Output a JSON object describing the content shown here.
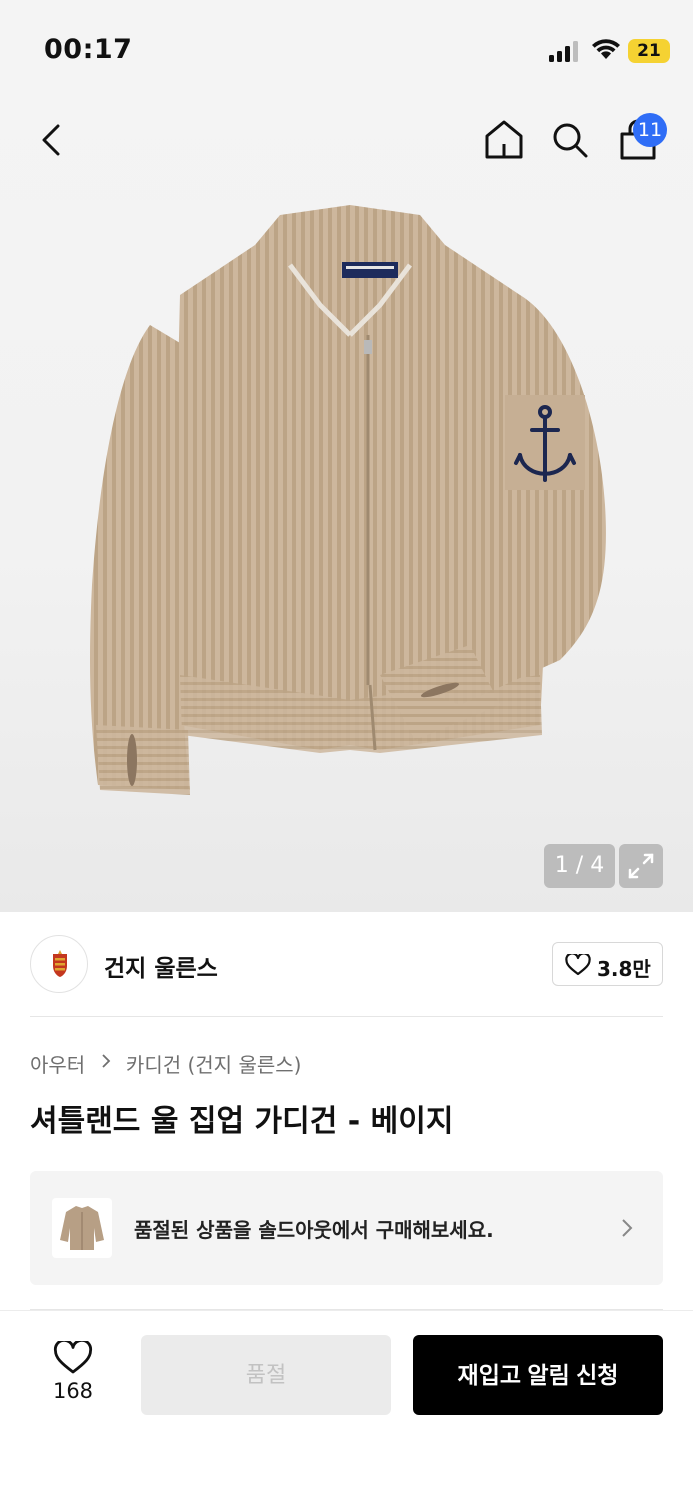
{
  "status_bar": {
    "time": "00:17",
    "battery": "21"
  },
  "header": {
    "cart_count": "11"
  },
  "gallery": {
    "counter": "1 / 4"
  },
  "brand": {
    "name": "건지 울른스",
    "likes": "3.8만"
  },
  "product": {
    "breadcrumb": {
      "category": "아우터",
      "subcategory": "카디건 (건지 울른스)"
    },
    "title": "셔틀랜드 울 집업 가디건 - 베이지"
  },
  "soldout_banner": {
    "text": "품절된 상품을 솔드아웃에서 구매해보세요."
  },
  "action_bar": {
    "wish_count": "168",
    "soldout_label": "품절",
    "restock_label": "재입고 알림 신청"
  },
  "colors": {
    "accent_badge": "#2f6df6",
    "battery": "#f5d232",
    "sweater": "#cbb49a",
    "primary_button": "#000000",
    "disabled_button": "#ebebeb"
  },
  "icons": [
    "back-icon",
    "home-icon",
    "search-icon",
    "shopping-bag-icon",
    "expand-icon",
    "heart-icon",
    "chevron-right-icon"
  ]
}
